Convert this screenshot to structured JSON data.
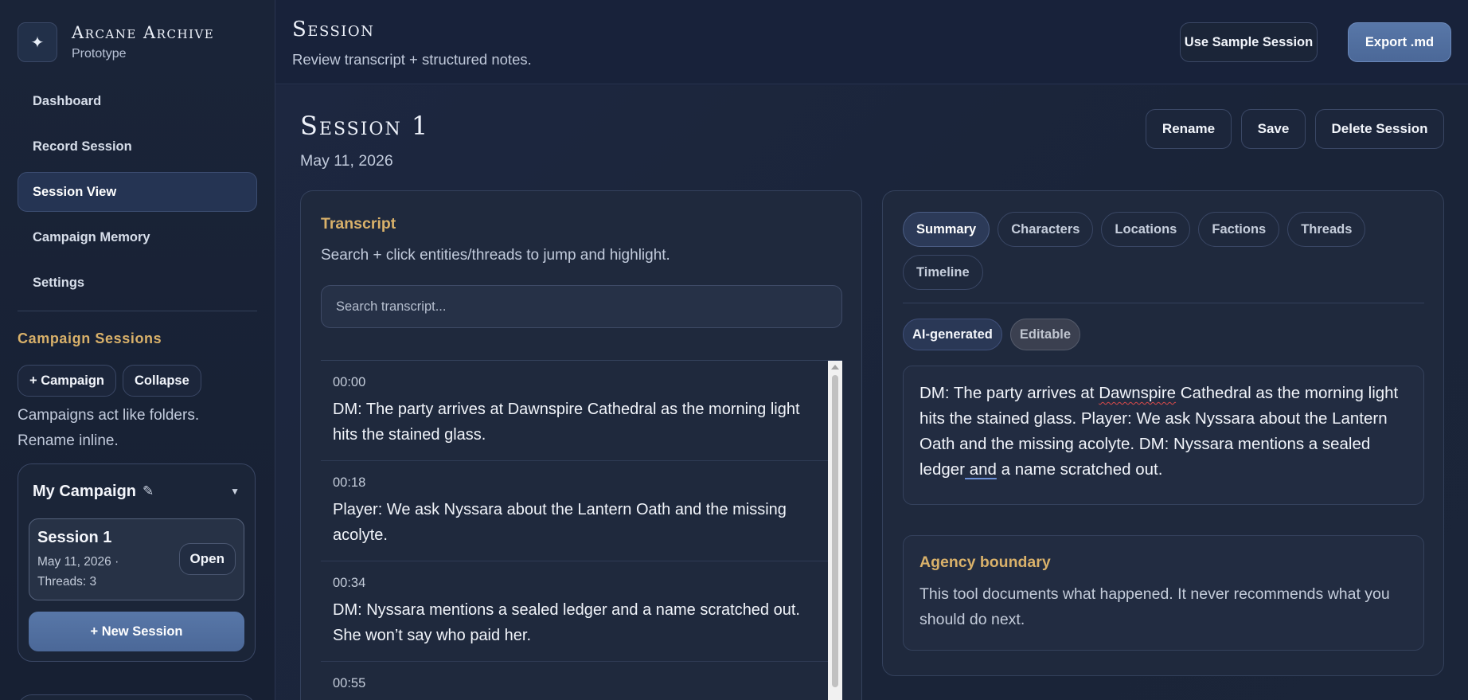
{
  "brand": {
    "logo_glyph": "✦",
    "title": "Arcane Archive",
    "subtitle": "Prototype"
  },
  "nav": {
    "items": [
      {
        "label": "Dashboard",
        "active": false
      },
      {
        "label": "Record Session",
        "active": false
      },
      {
        "label": "Session View",
        "active": true
      },
      {
        "label": "Campaign Memory",
        "active": false
      },
      {
        "label": "Settings",
        "active": false
      }
    ]
  },
  "campaigns": {
    "section_title": "Campaign Sessions",
    "add_campaign_label": "+ Campaign",
    "collapse_label": "Collapse",
    "note": "Campaigns act like folders. Rename inline.",
    "card": {
      "name": "My Campaign",
      "edit_icon": "pencil-icon",
      "toggle_icon": "chevron-down-icon",
      "session": {
        "title": "Session 1",
        "meta": "May 11, 2026 · Threads: 3",
        "open_label": "Open"
      },
      "new_session_label": "+ New Session"
    }
  },
  "header": {
    "title": "Session",
    "subtitle": "Review transcript + structured notes.",
    "sample_label": "Use Sample Session",
    "export_label": "Export .md"
  },
  "session": {
    "title": "Session 1",
    "date": "May 11, 2026",
    "rename_label": "Rename",
    "save_label": "Save",
    "delete_label": "Delete Session"
  },
  "transcript": {
    "heading": "Transcript",
    "subheading": "Search + click entities/threads to jump and highlight.",
    "search_placeholder": "Search transcript...",
    "entries": [
      {
        "time": "00:00",
        "text": "DM: The party arrives at Dawnspire Cathedral as the morning light hits the stained glass."
      },
      {
        "time": "00:18",
        "text": "Player: We ask Nyssara about the Lantern Oath and the missing acolyte."
      },
      {
        "time": "00:34",
        "text": "DM: Nyssara mentions a sealed ledger and a name scratched out. She won’t say who paid her."
      },
      {
        "time": "00:55",
        "text": ""
      }
    ]
  },
  "notes": {
    "tabs": [
      {
        "label": "Summary",
        "active": true
      },
      {
        "label": "Characters",
        "active": false
      },
      {
        "label": "Locations",
        "active": false
      },
      {
        "label": "Factions",
        "active": false
      },
      {
        "label": "Threads",
        "active": false
      },
      {
        "label": "Timeline",
        "active": false
      }
    ],
    "badge_ai": "AI-generated",
    "badge_editable": "Editable",
    "summary": {
      "part1": "DM: The party arrives at ",
      "word_spell": "Dawnspire",
      "part2": " Cathedral as the morning light hits the stained glass. Player: We ask Nyssara about the Lantern Oath and the missing acolyte. DM: Nyssara mentions a sealed ledger",
      "word_grammar": " and",
      "part3": " a name scratched out."
    },
    "agency": {
      "title": "Agency boundary",
      "text": "This tool documents what happened. It never recommends what you should do next."
    }
  },
  "colors": {
    "accent_gold": "#d9b16a",
    "primary_blue": "#5274a6",
    "background": "#18223a"
  }
}
